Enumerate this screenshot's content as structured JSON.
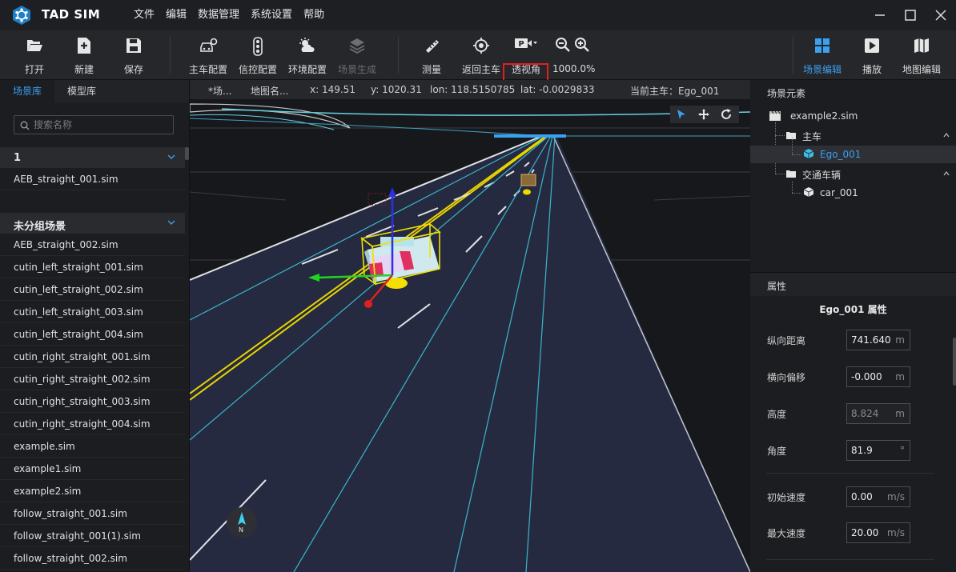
{
  "app": {
    "title": "TAD SIM"
  },
  "menu": [
    "文件",
    "编辑",
    "数据管理",
    "系统设置",
    "帮助"
  ],
  "toolbar": {
    "open": "打开",
    "new": "新建",
    "save": "保存",
    "ego_config": "主车配置",
    "signal_config": "信控配置",
    "env_config": "环境配置",
    "scene_gen": "场景生成",
    "measure": "测量",
    "back_to_ego": "返回主车",
    "perspective": "透视角",
    "zoom": "1000.0%",
    "scene_edit": "场景编辑",
    "playback": "播放",
    "map_edit": "地图编辑"
  },
  "left_panel": {
    "tabs": [
      "场景库",
      "模型库"
    ],
    "search_placeholder": "搜索名称",
    "groups": [
      {
        "name": "1",
        "files": [
          "AEB_straight_001.sim"
        ]
      },
      {
        "name": "未分组场景",
        "files": [
          "AEB_straight_002.sim",
          "cutin_left_straight_001.sim",
          "cutin_left_straight_002.sim",
          "cutin_left_straight_003.sim",
          "cutin_left_straight_004.sim",
          "cutin_right_straight_001.sim",
          "cutin_right_straight_002.sim",
          "cutin_right_straight_003.sim",
          "cutin_right_straight_004.sim",
          "example.sim",
          "example1.sim",
          "example2.sim",
          "follow_straight_001.sim",
          "follow_straight_001(1).sim",
          "follow_straight_002.sim"
        ]
      }
    ]
  },
  "viewport": {
    "info": {
      "scene": "*场...",
      "map": "地图名...",
      "x": "x: 149.51",
      "y": "y: 1020.31",
      "lon": "lon: 118.5150785",
      "lat": "lat: -0.0029833",
      "ego": "当前主车：Ego_001"
    },
    "compass_label": "N"
  },
  "right_panel": {
    "elements_title": "场景元素",
    "tree": {
      "file": "example2.sim",
      "ego_group": "主车",
      "ego": "Ego_001",
      "traffic_group": "交通车辆",
      "car": "car_001"
    },
    "props_header": "属性",
    "props_title": "Ego_001 属性",
    "props": [
      {
        "label": "纵向距离",
        "value": "741.640",
        "unit": "m",
        "disabled": false
      },
      {
        "label": "横向偏移",
        "value": "-0.000",
        "unit": "m",
        "disabled": false
      },
      {
        "label": "高度",
        "value": "8.824",
        "unit": "m",
        "disabled": true
      },
      {
        "label": "角度",
        "value": "81.9",
        "unit": "°",
        "disabled": false
      },
      {
        "label": "初始速度",
        "value": "0.00",
        "unit": "m/s",
        "disabled": false
      },
      {
        "label": "最大速度",
        "value": "20.00",
        "unit": "m/s",
        "disabled": false
      }
    ]
  },
  "colors": {
    "accent": "#3aa0f0",
    "highlight": "#e02020"
  }
}
